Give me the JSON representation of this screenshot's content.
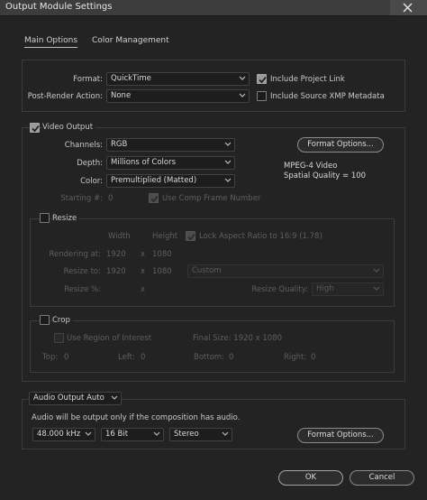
{
  "window": {
    "title": "Output Module Settings"
  },
  "tabs": [
    {
      "label": "Main Options",
      "active": true
    },
    {
      "label": "Color Management",
      "active": false
    }
  ],
  "main": {
    "format": {
      "label": "Format:",
      "value": "QuickTime"
    },
    "post_render": {
      "label": "Post-Render Action:",
      "value": "None"
    },
    "include_project_link": {
      "label": "Include Project Link",
      "checked": true
    },
    "include_xmp": {
      "label": "Include Source XMP Metadata",
      "checked": false
    }
  },
  "video": {
    "header": {
      "label": "Video Output",
      "checked": true
    },
    "channels": {
      "label": "Channels:",
      "value": "RGB"
    },
    "depth": {
      "label": "Depth:",
      "value": "Millions of Colors"
    },
    "color": {
      "label": "Color:",
      "value": "Premultiplied (Matted)"
    },
    "starting": {
      "label": "Starting #:",
      "value": "0"
    },
    "use_comp_frame": {
      "label": "Use Comp Frame Number",
      "checked": true
    },
    "format_options_label": "Format Options...",
    "codec_line1": "MPEG-4 Video",
    "codec_line2": "Spatial Quality = 100"
  },
  "resize": {
    "header": {
      "label": "Resize",
      "checked": false
    },
    "width_col": "Width",
    "height_col": "Height",
    "lock_aspect": {
      "label": "Lock Aspect Ratio to 16:9 (1.78)",
      "checked": true
    },
    "rendering_at": {
      "label": "Rendering at:",
      "w": "1920",
      "x": "x",
      "h": "1080"
    },
    "resize_to": {
      "label": "Resize to:",
      "w": "1920",
      "x": "x",
      "h": "1080",
      "preset": "Custom"
    },
    "resize_pct": {
      "label": "Resize %:",
      "x": "x"
    },
    "quality": {
      "label": "Resize Quality:",
      "value": "High"
    }
  },
  "crop": {
    "header": {
      "label": "Crop",
      "checked": false
    },
    "use_roi": {
      "label": "Use Region of Interest",
      "checked": false
    },
    "final_size": "Final Size: 1920 x 1080",
    "top": {
      "label": "Top:",
      "value": "0"
    },
    "left": {
      "label": "Left:",
      "value": "0"
    },
    "bottom": {
      "label": "Bottom:",
      "value": "0"
    },
    "right": {
      "label": "Right:",
      "value": "0"
    }
  },
  "audio": {
    "mode": "Audio Output Auto",
    "note": "Audio will be output only if the composition has audio.",
    "rate": "48.000 kHz",
    "bits": "16 Bit",
    "channels": "Stereo",
    "format_options_label": "Format Options..."
  },
  "footer": {
    "ok": "OK",
    "cancel": "Cancel"
  }
}
